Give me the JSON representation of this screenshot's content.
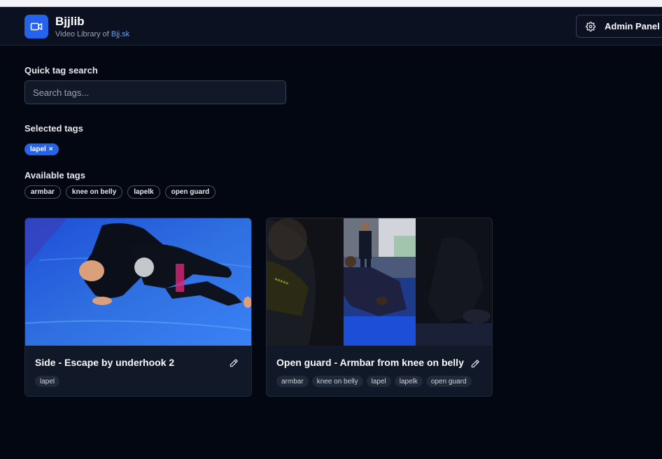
{
  "header": {
    "app_title": "Bjjlib",
    "subtitle_prefix": "Video Library of ",
    "subtitle_link": "Bjj.sk",
    "logo_icon": "video-camera-icon",
    "admin_button_label": "Admin Panel",
    "admin_button_icon": "gear-icon"
  },
  "search": {
    "label": "Quick tag search",
    "placeholder": "Search tags...",
    "value": ""
  },
  "selected_tags": {
    "label": "Selected tags",
    "items": [
      {
        "label": "lapel",
        "remove_glyph": "×"
      }
    ]
  },
  "available_tags": {
    "label": "Available tags",
    "items": [
      "armbar",
      "knee on belly",
      "lapelk",
      "open guard"
    ]
  },
  "videos": [
    {
      "title": "Side - Escape by underhook 2",
      "tags": [
        "lapel"
      ],
      "thumbnail": "single-frame-blue-mat",
      "edit_icon": "pencil-icon"
    },
    {
      "title": "Open guard - Armbar from knee on belly",
      "tags": [
        "armbar",
        "knee on belly",
        "lapel",
        "lapelk",
        "open guard"
      ],
      "thumbnail": "three-frame-collage",
      "edit_icon": "pencil-icon"
    }
  ],
  "colors": {
    "background": "#030712",
    "accent": "#2563eb",
    "link": "#60a5fa",
    "card": "#111827"
  }
}
